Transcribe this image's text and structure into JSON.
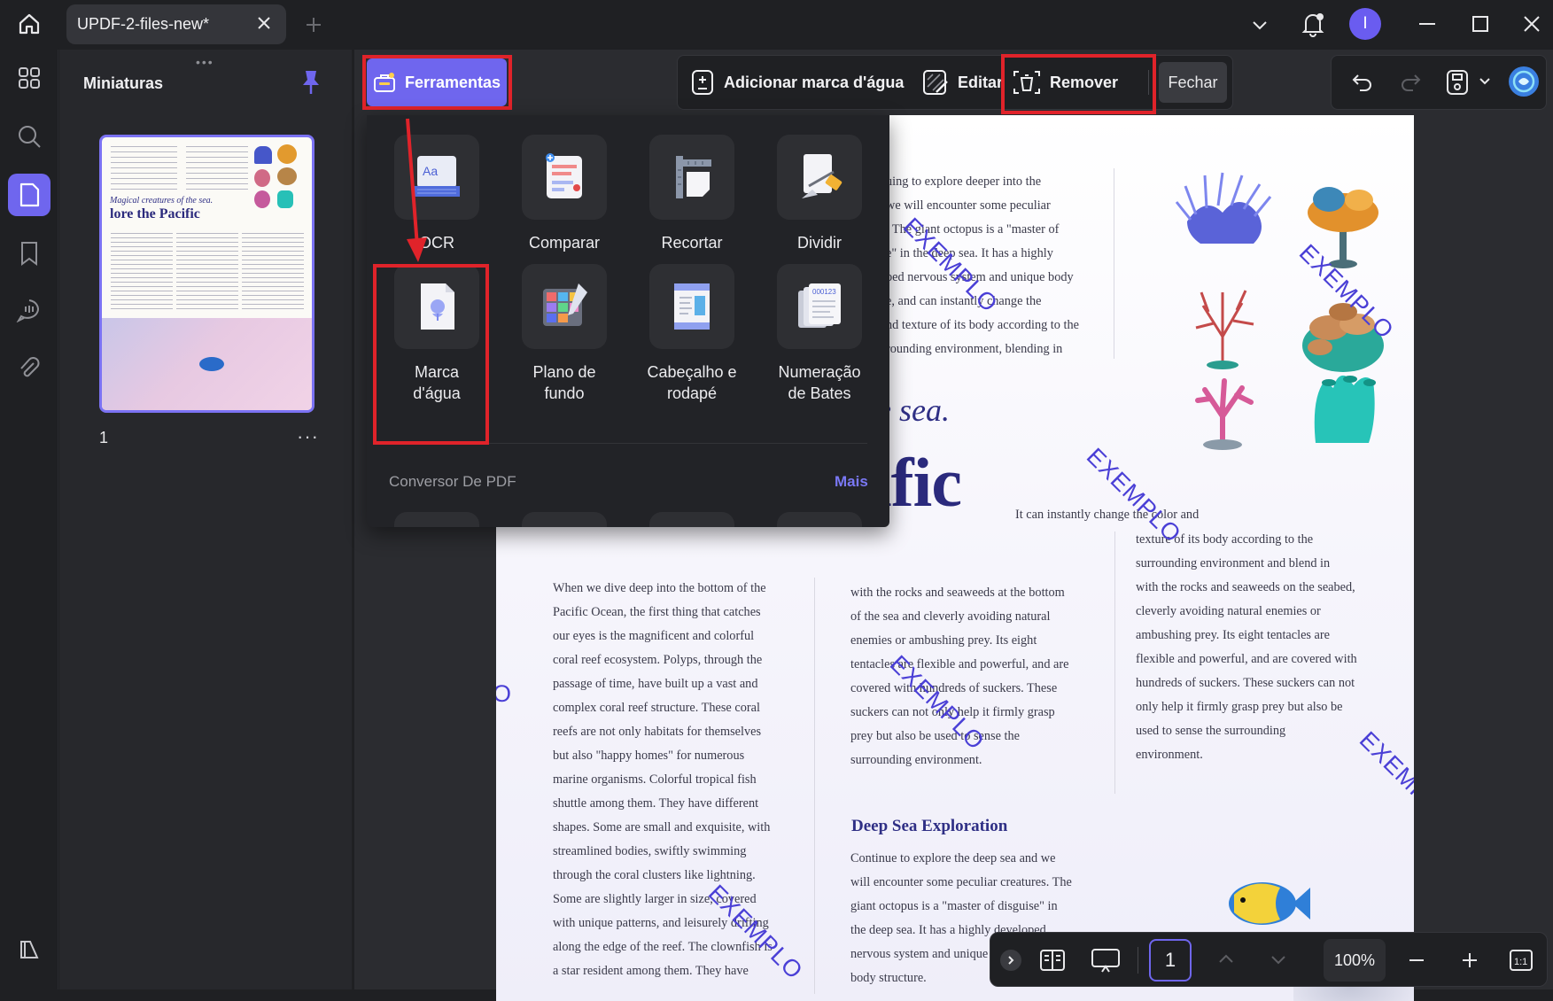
{
  "window": {
    "tab_title": "UPDF-2-files-new*",
    "avatar_initial": "I"
  },
  "thumbnails_panel": {
    "title": "Miniaturas",
    "page_number": "1",
    "thumb_heading_italic": "Magical creatures of the sea.",
    "thumb_heading_bold": "lore the Pacific"
  },
  "toolbar": {
    "tools_button": "Ferramentas",
    "add_watermark": "Adicionar marca d'água",
    "edit": "Editar",
    "remove": "Remover",
    "close": "Fechar"
  },
  "tools_panel": {
    "tools": [
      {
        "label": "OCR",
        "icon": "ocr-icon"
      },
      {
        "label": "Comparar",
        "icon": "compare-icon"
      },
      {
        "label": "Recortar",
        "icon": "crop-icon"
      },
      {
        "label": "Dividir",
        "icon": "split-icon"
      },
      {
        "label": "Marca\nd'água",
        "icon": "watermark-icon"
      },
      {
        "label": "Plano de\nfundo",
        "icon": "background-icon"
      },
      {
        "label": "Cabeçalho e\nrodapé",
        "icon": "header-footer-icon"
      },
      {
        "label": "Numeração\nde Bates",
        "icon": "bates-numbering-icon"
      }
    ],
    "section_label": "Conversor De PDF",
    "more_link": "Mais"
  },
  "document": {
    "watermark_text": "EXEMPLO",
    "top_para": [
      "uing to explore deeper into the",
      "we will encounter some peculiar",
      ". The giant octopus is a \"master of",
      "e\" in the deep sea. It has a highly",
      "bed nervous system and unique body",
      "e, and can instantly change the",
      "nd texture of its body according to the",
      "rounding environment, blending in"
    ],
    "heading_italic_fragment": "e sea.",
    "heading_big_fragment": "ific",
    "right_intro": "It can instantly change the color and",
    "right_col": [
      "texture of its body according to the",
      "surrounding environment and blend in",
      "with the rocks and seaweeds on the seabed,",
      "cleverly avoiding natural enemies or",
      "ambushing prey. Its eight tentacles are",
      "flexible and powerful, and are covered with",
      "hundreds of suckers. These suckers can not",
      "only help it firmly grasp prey but also be",
      "used to sense the surrounding",
      "environment."
    ],
    "left_col": [
      "When we dive deep into the bottom of the",
      "Pacific Ocean, the first thing that catches",
      "our eyes is the magnificent and colorful",
      "coral reef ecosystem. Polyps, through the",
      "passage of time, have built up a vast and",
      "complex coral reef structure. These coral",
      "reefs are not only habitats for themselves",
      "but also \"happy homes\" for numerous",
      "marine organisms. Colorful tropical fish",
      "shuttle among them. They have different",
      "shapes. Some are small and exquisite, with",
      "streamlined bodies, swiftly swimming",
      "through the coral clusters like lightning.",
      "Some are slightly larger in size, covered",
      "with unique patterns, and leisurely drifting",
      "along the edge of the reef. The clownfish is",
      "a star resident among them. They have"
    ],
    "mid_col": [
      "with the rocks and seaweeds at the bottom",
      "of the sea and cleverly avoiding natural",
      "enemies or ambushing prey. Its eight",
      "tentacles are flexible and powerful, and are",
      "covered with hundreds of suckers. These",
      "suckers can not only help it firmly grasp",
      "prey but also be used to sense the",
      "surrounding environment."
    ],
    "section_heading": "Deep Sea Exploration",
    "section_para": [
      "Continue to explore the deep sea and we",
      "will encounter some peculiar creatures. The",
      "giant octopus is a \"master of disguise\" in",
      "the deep sea. It has a highly developed",
      "nervous system and unique",
      "body structure."
    ]
  },
  "bottom_bar": {
    "page_input": "1",
    "zoom": "100%"
  },
  "colors": {
    "accent": "#6f66ee",
    "highlight_box": "#e0232a",
    "watermark": "#4a3fd6"
  }
}
